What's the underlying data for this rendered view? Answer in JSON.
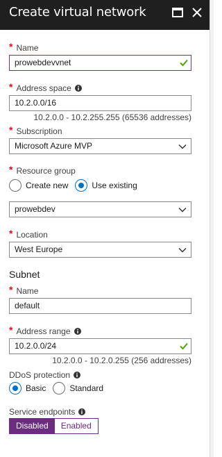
{
  "header": {
    "title": "Create virtual network"
  },
  "fields": {
    "name": {
      "label": "Name",
      "value": "prowebdevvnet"
    },
    "address_space": {
      "label": "Address space",
      "value": "10.2.0.0/16",
      "hint": "10.2.0.0 - 10.2.255.255 (65536 addresses)"
    },
    "subscription": {
      "label": "Subscription",
      "value": "Microsoft Azure MVP"
    },
    "resource_group": {
      "label": "Resource group",
      "option_new": "Create new",
      "option_existing": "Use existing",
      "value": "prowebdev"
    },
    "location": {
      "label": "Location",
      "value": "West Europe"
    }
  },
  "subnet": {
    "heading": "Subnet",
    "name": {
      "label": "Name",
      "value": "default"
    },
    "address_range": {
      "label": "Address range",
      "value": "10.2.0.0/24",
      "hint": "10.2.0.0 - 10.2.0.255 (256 addresses)"
    }
  },
  "ddos": {
    "label": "DDoS protection",
    "option_basic": "Basic",
    "option_standard": "Standard"
  },
  "service_endpoints": {
    "label": "Service endpoints",
    "disabled": "Disabled",
    "enabled": "Enabled"
  },
  "colors": {
    "accent": "#6b2c82",
    "radio": "#0072c6",
    "required": "#e00b1c",
    "valid": "#57a300",
    "header": "#1f1f1f"
  },
  "icons": [
    "maximize-icon",
    "close-icon",
    "info-icon",
    "check-icon",
    "chevron-down-icon"
  ]
}
